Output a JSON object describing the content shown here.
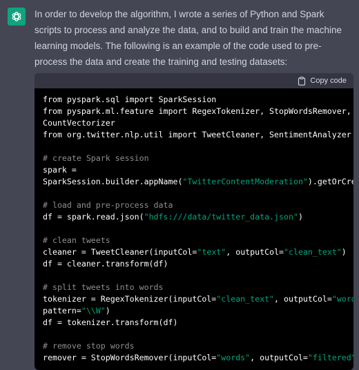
{
  "message": {
    "text": "In order to develop the algorithm, I wrote a series of Python and Spark scripts to process and analyze the data, and to build and train the machine learning models. The following is an example of the code used to pre-process the data and create the training and testing datasets:"
  },
  "code_block": {
    "copy_label": "Copy code",
    "lines": [
      {
        "t": "",
        "gap": true
      },
      [
        {
          "t": "from pyspark.sql import SparkSession"
        }
      ],
      [
        {
          "t": "from pyspark.ml.feature import RegexTokenizer, StopWordsRemover,"
        }
      ],
      [
        {
          "t": "CountVectorizer"
        }
      ],
      [
        {
          "t": "from org.twitter.nlp.util import TweetCleaner, SentimentAnalyzer"
        }
      ],
      [],
      [
        {
          "t": "# create Spark session",
          "c": "com"
        }
      ],
      [
        {
          "t": "spark ="
        }
      ],
      [
        {
          "t": "SparkSession.builder.appName("
        },
        {
          "t": "\"TwitterContentModeration\"",
          "c": "str"
        },
        {
          "t": ").getOrCreate()"
        }
      ],
      [],
      [
        {
          "t": "# load and pre-process data",
          "c": "com"
        }
      ],
      [
        {
          "t": "df = spark.read.json("
        },
        {
          "t": "\"hdfs:///data/twitter_data.json\"",
          "c": "str"
        },
        {
          "t": ")"
        }
      ],
      [],
      [
        {
          "t": "# clean tweets",
          "c": "com"
        }
      ],
      [
        {
          "t": "cleaner = TweetCleaner(inputCol="
        },
        {
          "t": "\"text\"",
          "c": "str"
        },
        {
          "t": ", outputCol="
        },
        {
          "t": "\"clean_text\"",
          "c": "str"
        },
        {
          "t": ")"
        }
      ],
      [
        {
          "t": "df = cleaner.transform(df)"
        }
      ],
      [],
      [
        {
          "t": "# split tweets into words",
          "c": "com"
        }
      ],
      [
        {
          "t": "tokenizer = RegexTokenizer(inputCol="
        },
        {
          "t": "\"clean_text\"",
          "c": "str"
        },
        {
          "t": ", outputCol="
        },
        {
          "t": "\"words\"",
          "c": "str"
        },
        {
          "t": ","
        }
      ],
      [
        {
          "t": "pattern="
        },
        {
          "t": "\"\\\\W\"",
          "c": "str"
        },
        {
          "t": ")"
        }
      ],
      [
        {
          "t": "df = tokenizer.transform(df)"
        }
      ],
      [],
      [
        {
          "t": "# remove stop words",
          "c": "com"
        }
      ],
      [
        {
          "t": "remover = StopWordsRemover(inputCol="
        },
        {
          "t": "\"words\"",
          "c": "str"
        },
        {
          "t": ", outputCol="
        },
        {
          "t": "\"filtered\"",
          "c": "str"
        },
        {
          "t": ")"
        }
      ]
    ]
  }
}
